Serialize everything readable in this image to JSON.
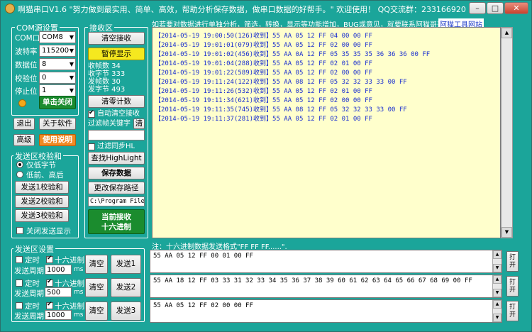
{
  "window": {
    "title": "啊猫串口V1.6   \"努力做到最实用、简单、高效，帮助分析保存数据，做串口数据的好帮手。\" 欢迎使用！ QQ交流群：233166920",
    "min": "–",
    "max": "□",
    "close": "✕"
  },
  "com": {
    "group": "COM源设置",
    "port_label": "COM口",
    "port": "COM8",
    "baud_label": "波特率",
    "baud": "115200",
    "data_label": "数据位",
    "data": "8",
    "parity_label": "校验位",
    "parity": "0",
    "stop_label": "停止位",
    "stop": "1",
    "close_btn": "单击关闭",
    "dropdown_arrow": "▼",
    "status_color": "#f5a81a"
  },
  "left_buttons": {
    "exit": "退出",
    "about": "关于软件",
    "advanced": "高级",
    "help": "使用说明"
  },
  "checksum": {
    "group": "发送区校验和",
    "opt1": "仅低字节",
    "opt2": "低前、高后",
    "send1": "发送1校验和",
    "send2": "发送2校验和",
    "send3": "发送3校验和",
    "hide": "关闭发送显示"
  },
  "rx_ctrl": {
    "group": "接收区",
    "clear": "清空接收",
    "pause": "暂停显示",
    "rx_frames": "收帧数 34",
    "rx_bytes": "收字节 333",
    "tx_frames": "发帧数 30",
    "tx_bytes": "发字节 493",
    "clear_count": "清零计数",
    "auto_clear": "自动清空接收",
    "filter_label": "过滤帧关键字",
    "filter_clear": "清",
    "filter_value": "",
    "sync_filter": "过滤同步HL",
    "find": "查找HighLight",
    "save": "保存数据",
    "change_path": "更改保存路径",
    "path": "C:\\Program Files",
    "mode_line1": "当前接收",
    "mode_line2": "十六进制"
  },
  "rx_header": {
    "text": "如若要对数据进行单独分析，筛选，转换，显示等功能增加，BUG或意见，就要联系阿猫哥哥了.",
    "link": "阿猫工具网站"
  },
  "rx_lines": [
    "【2014-05-19 19:00:50(126)收到】55 AA 05 12 FF 04 00 00 FF",
    "【2014-05-19 19:01:01(079)收到】55 AA 05 12 FF 02 00 00 FF",
    "【2014-05-19 19:01:02(456)收到】55 AA 0A 12 FF 05 35 35 35 36 36 36 00 FF",
    "【2014-05-19 19:01:04(288)收到】55 AA 05 12 FF 02 01 00 FF",
    "【2014-05-19 19:01:22(589)收到】55 AA 05 12 FF 02 00 00 FF",
    "【2014-05-19 19:11:24(122)收到】55 AA 08 12 FF 05 32 32 33 33 00 FF",
    "【2014-05-19 19:11:26(532)收到】55 AA 05 12 FF 02 01 00 FF",
    "【2014-05-19 19:11:34(621)收到】55 AA 05 12 FF 02 00 00 FF",
    "【2014-05-19 19:11:35(745)收到】55 AA 08 12 FF 05 32 32 33 33 00 FF",
    "【2014-05-19 19:11:37(281)收到】55 AA 05 12 FF 02 01 00 FF"
  ],
  "tx_settings": {
    "group": "发送区设置",
    "hint": "注：十六进制数据发送格式\"FF FF FF......\".",
    "timer": "定时",
    "hex": "十六进制",
    "period": "发送周期",
    "ms": "ms",
    "clear": "清空",
    "open": "打开",
    "rows": [
      {
        "period": "1000",
        "send": "发送1",
        "data": "55 AA 05 12 FF 00 01 00 FF"
      },
      {
        "period": "500",
        "send": "发送2",
        "data": "55 AA 18 12 FF 03 33 31 32 33 34 35 36 37 38 39 60 61 62 63 64 65 66 67 68 69 00 FF"
      },
      {
        "period": "1000",
        "send": "发送3",
        "data": "55 AA 05 12 FF 02 00 00 FF"
      }
    ]
  },
  "icons": {
    "up": "▲",
    "down": "▼",
    "check": "✔"
  }
}
